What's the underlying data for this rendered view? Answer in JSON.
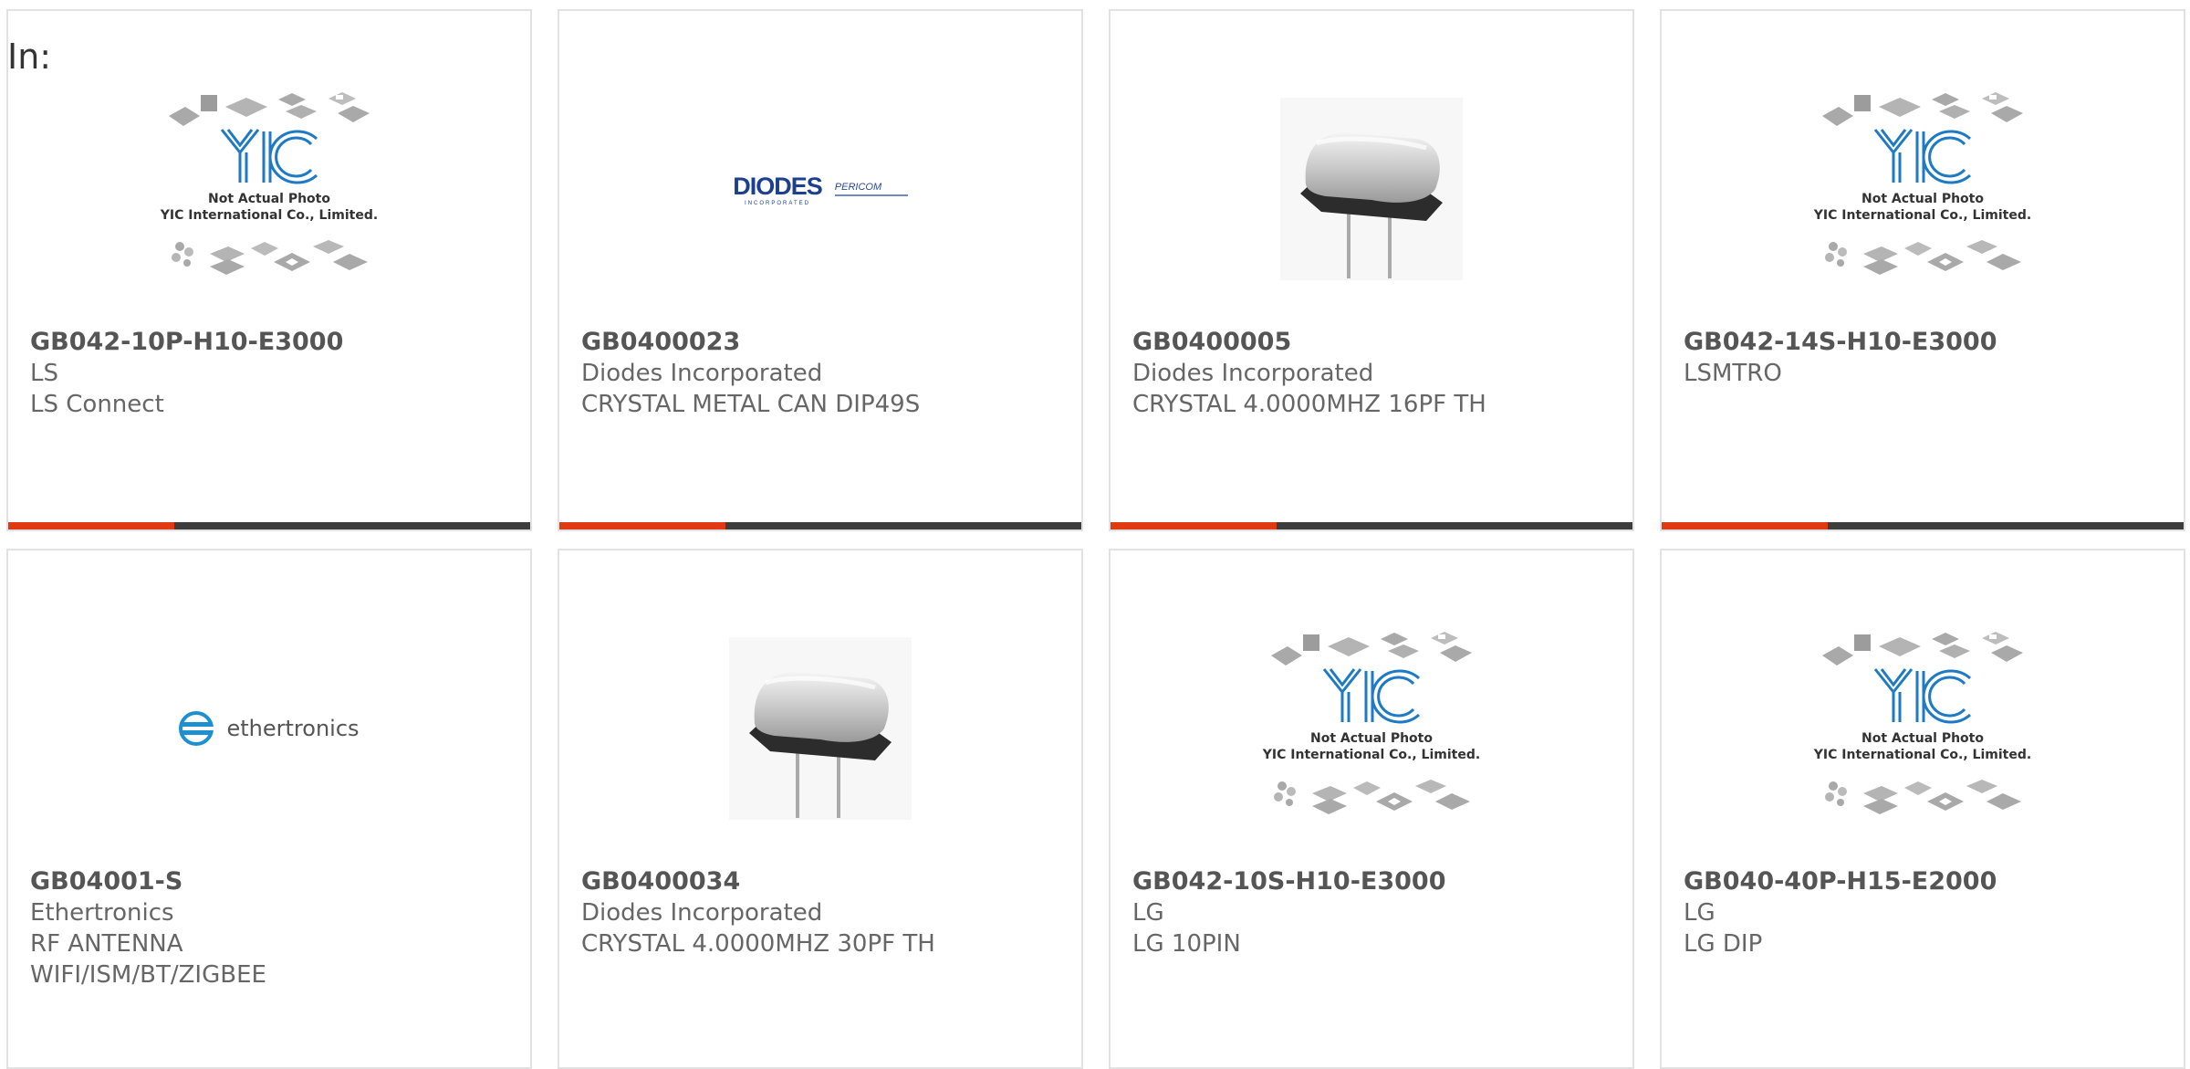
{
  "header": {
    "in_label": "In:"
  },
  "colors": {
    "accent": "#e03a12",
    "bar": "#3d3d3d",
    "yic_blue": "#1e7ac4"
  },
  "placeholder": {
    "line1": "Not Actual Photo",
    "line2": "YIC International Co., Limited."
  },
  "logos": {
    "diodes": "DIODES",
    "diodes_sub": "INCORPORATED",
    "pericom": "PERICOM",
    "ethertronics": "ethertronics"
  },
  "products": [
    {
      "part": "GB042-10P-H10-E3000",
      "manufacturer": "LS",
      "desc1": "LS Connect",
      "desc2": "",
      "image": "yic-placeholder"
    },
    {
      "part": "GB0400023",
      "manufacturer": "Diodes Incorporated",
      "desc1": "CRYSTAL METAL CAN DIP49S",
      "desc2": "",
      "image": "diodes-logo"
    },
    {
      "part": "GB0400005",
      "manufacturer": "Diodes Incorporated",
      "desc1": "CRYSTAL 4.0000MHZ 16PF TH",
      "desc2": "",
      "image": "crystal-photo"
    },
    {
      "part": "GB042-14S-H10-E3000",
      "manufacturer": "LSMTRO",
      "desc1": "",
      "desc2": "",
      "image": "yic-placeholder"
    },
    {
      "part": "GB04001-S",
      "manufacturer": "Ethertronics",
      "desc1": "RF ANTENNA",
      "desc2": "WIFI/ISM/BT/ZIGBEE",
      "image": "ethertronics-logo"
    },
    {
      "part": "GB0400034",
      "manufacturer": "Diodes Incorporated",
      "desc1": "CRYSTAL 4.0000MHZ 30PF TH",
      "desc2": "",
      "image": "crystal-photo"
    },
    {
      "part": "GB042-10S-H10-E3000",
      "manufacturer": "LG",
      "desc1": "LG 10PIN",
      "desc2": "",
      "image": "yic-placeholder"
    },
    {
      "part": "GB040-40P-H15-E2000",
      "manufacturer": "LG",
      "desc1": "LG DIP",
      "desc2": "",
      "image": "yic-placeholder"
    }
  ]
}
